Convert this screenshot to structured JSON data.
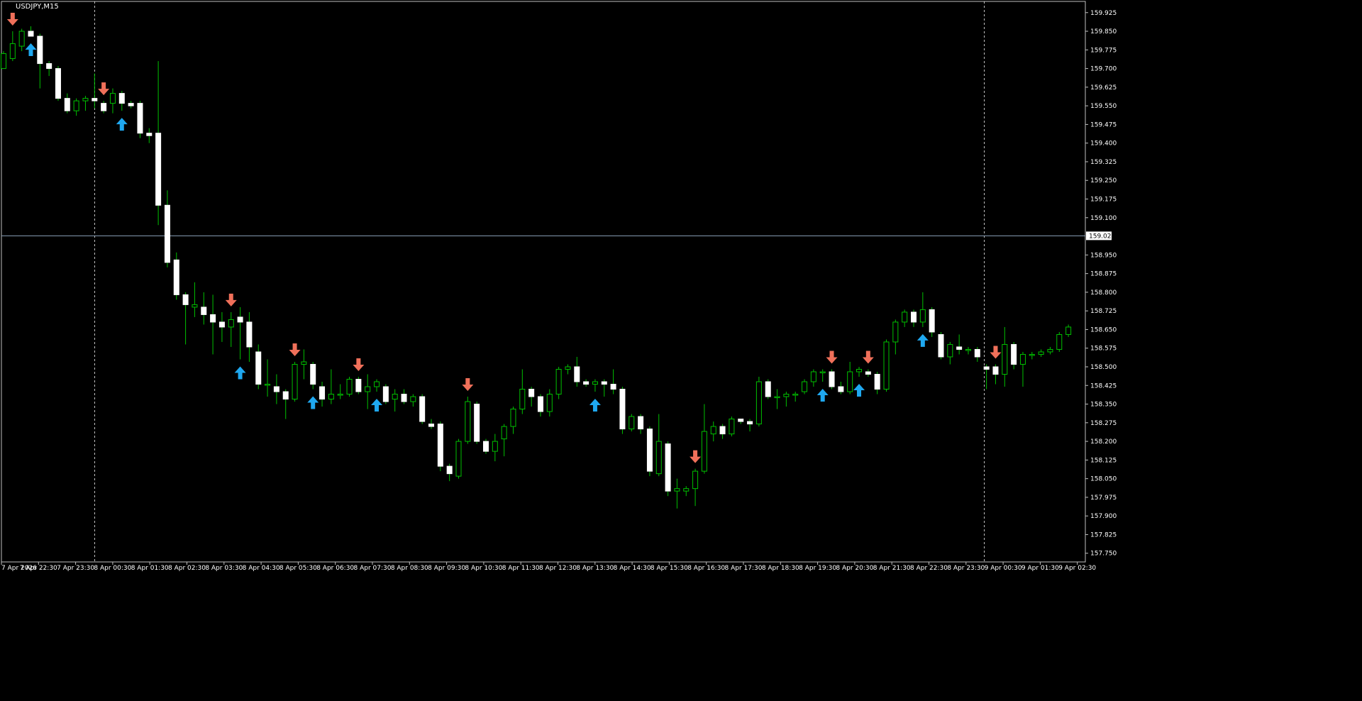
{
  "symbol_label": "USDJPY,M15",
  "current_price": "159.027",
  "colors": {
    "background": "#000000",
    "frame": "#c0c0c0",
    "axis_text": "#ffffff",
    "bull_body": "#000000",
    "bull_outline": "#00c000",
    "bear_body": "#ffffff",
    "wick": "#00c000",
    "price_line": "#8aa0b8",
    "separator": "#c0c0c0",
    "buy_arrow": "#1fa8f0",
    "sell_arrow": "#f0705a"
  },
  "chart_data": {
    "type": "candlestick",
    "symbol": "USDJPY",
    "timeframe": "M15",
    "ylim": [
      157.715,
      159.97
    ],
    "y_ticks": [
      "159.925",
      "159.850",
      "159.775",
      "159.700",
      "159.625",
      "159.550",
      "159.475",
      "159.400",
      "159.325",
      "159.250",
      "159.175",
      "159.100",
      "158.950",
      "158.875",
      "158.800",
      "158.725",
      "158.650",
      "158.575",
      "158.500",
      "158.425",
      "158.350",
      "158.275",
      "158.200",
      "158.125",
      "158.050",
      "157.975",
      "157.900",
      "157.825",
      "157.750"
    ],
    "x_ticks": [
      "7 Apr 2026",
      "7 Apr 22:30",
      "7 Apr 23:30",
      "8 Apr 00:30",
      "8 Apr 01:30",
      "8 Apr 02:30",
      "8 Apr 03:30",
      "8 Apr 04:30",
      "8 Apr 05:30",
      "8 Apr 06:30",
      "8 Apr 07:30",
      "8 Apr 08:30",
      "8 Apr 09:30",
      "8 Apr 10:30",
      "8 Apr 11:30",
      "8 Apr 12:30",
      "8 Apr 13:30",
      "8 Apr 14:30",
      "8 Apr 15:30",
      "8 Apr 16:30",
      "8 Apr 17:30",
      "8 Apr 18:30",
      "8 Apr 19:30",
      "8 Apr 20:30",
      "8 Apr 21:30",
      "8 Apr 22:30",
      "8 Apr 23:30",
      "9 Apr 00:30",
      "9 Apr 01:30",
      "9 Apr 02:30"
    ],
    "current_price": 159.027,
    "candles": [
      [
        159.7,
        159.76,
        159.7,
        159.77
      ],
      [
        159.74,
        159.8,
        159.73,
        159.85
      ],
      [
        159.79,
        159.85,
        159.77,
        159.86
      ],
      [
        159.85,
        159.83,
        159.83,
        159.87
      ],
      [
        159.83,
        159.72,
        159.62,
        159.84
      ],
      [
        159.72,
        159.7,
        159.67,
        159.73
      ],
      [
        159.7,
        159.58,
        159.57,
        159.71
      ],
      [
        159.58,
        159.53,
        159.52,
        159.6
      ],
      [
        159.53,
        159.57,
        159.51,
        159.58
      ],
      [
        159.57,
        159.58,
        159.53,
        159.59
      ],
      [
        159.58,
        159.57,
        159.54,
        159.68
      ],
      [
        159.56,
        159.53,
        159.52,
        159.57
      ],
      [
        159.56,
        159.6,
        159.52,
        159.62
      ],
      [
        159.6,
        159.56,
        159.53,
        159.61
      ],
      [
        159.56,
        159.55,
        159.54,
        159.57
      ],
      [
        159.56,
        159.44,
        159.42,
        159.57
      ],
      [
        159.44,
        159.43,
        159.4,
        159.46
      ],
      [
        159.44,
        159.15,
        159.07,
        159.73
      ],
      [
        159.15,
        158.92,
        158.9,
        159.21
      ],
      [
        158.93,
        158.79,
        158.77,
        158.96
      ],
      [
        158.79,
        158.75,
        158.59,
        158.8
      ],
      [
        158.74,
        158.75,
        158.7,
        158.84
      ],
      [
        158.74,
        158.71,
        158.67,
        158.8
      ],
      [
        158.71,
        158.68,
        158.55,
        158.79
      ],
      [
        158.68,
        158.66,
        158.6,
        158.72
      ],
      [
        158.66,
        158.69,
        158.58,
        158.72
      ],
      [
        158.7,
        158.68,
        158.53,
        158.74
      ],
      [
        158.68,
        158.58,
        158.52,
        158.72
      ],
      [
        158.56,
        158.43,
        158.41,
        158.59
      ],
      [
        158.43,
        158.43,
        158.38,
        158.53
      ],
      [
        158.42,
        158.4,
        158.35,
        158.47
      ],
      [
        158.4,
        158.37,
        158.29,
        158.41
      ],
      [
        158.37,
        158.51,
        158.36,
        158.52
      ],
      [
        158.51,
        158.52,
        158.45,
        158.57
      ],
      [
        158.51,
        158.43,
        158.41,
        158.52
      ],
      [
        158.42,
        158.37,
        158.34,
        158.44
      ],
      [
        158.37,
        158.39,
        158.35,
        158.49
      ],
      [
        158.39,
        158.39,
        158.37,
        158.43
      ],
      [
        158.39,
        158.45,
        158.38,
        158.46
      ],
      [
        158.45,
        158.4,
        158.39,
        158.46
      ],
      [
        158.4,
        158.42,
        158.33,
        158.47
      ],
      [
        158.42,
        158.44,
        158.4,
        158.45
      ],
      [
        158.42,
        158.36,
        158.35,
        158.43
      ],
      [
        158.37,
        158.39,
        158.32,
        158.41
      ],
      [
        158.39,
        158.36,
        158.35,
        158.41
      ],
      [
        158.36,
        158.38,
        158.34,
        158.39
      ],
      [
        158.38,
        158.28,
        158.27,
        158.39
      ],
      [
        158.27,
        158.26,
        158.25,
        158.29
      ],
      [
        158.27,
        158.1,
        158.08,
        158.28
      ],
      [
        158.1,
        158.07,
        158.04,
        158.11
      ],
      [
        158.06,
        158.2,
        158.05,
        158.21
      ],
      [
        158.2,
        158.36,
        158.19,
        158.38
      ],
      [
        158.35,
        158.2,
        158.19,
        158.36
      ],
      [
        158.2,
        158.16,
        158.15,
        158.21
      ],
      [
        158.16,
        158.2,
        158.12,
        158.23
      ],
      [
        158.21,
        158.26,
        158.14,
        158.27
      ],
      [
        158.26,
        158.33,
        158.23,
        158.34
      ],
      [
        158.33,
        158.41,
        158.31,
        158.49
      ],
      [
        158.41,
        158.38,
        158.34,
        158.42
      ],
      [
        158.38,
        158.32,
        158.3,
        158.39
      ],
      [
        158.32,
        158.39,
        158.3,
        158.41
      ],
      [
        158.39,
        158.49,
        158.37,
        158.5
      ],
      [
        158.49,
        158.5,
        158.47,
        158.51
      ],
      [
        158.5,
        158.44,
        158.42,
        158.54
      ],
      [
        158.44,
        158.43,
        158.42,
        158.45
      ],
      [
        158.43,
        158.44,
        158.4,
        158.45
      ],
      [
        158.44,
        158.43,
        158.38,
        158.45
      ],
      [
        158.43,
        158.41,
        158.39,
        158.49
      ],
      [
        158.41,
        158.25,
        158.23,
        158.42
      ],
      [
        158.25,
        158.3,
        158.24,
        158.31
      ],
      [
        158.3,
        158.25,
        158.23,
        158.31
      ],
      [
        158.25,
        158.08,
        158.06,
        158.26
      ],
      [
        158.07,
        158.2,
        158.06,
        158.31
      ],
      [
        158.19,
        158.0,
        157.98,
        158.2
      ],
      [
        158.0,
        158.01,
        157.93,
        158.05
      ],
      [
        158.0,
        158.01,
        157.98,
        158.02
      ],
      [
        158.01,
        158.08,
        157.94,
        158.09
      ],
      [
        158.08,
        158.24,
        158.07,
        158.35
      ],
      [
        158.23,
        158.26,
        158.2,
        158.28
      ],
      [
        158.26,
        158.23,
        158.21,
        158.27
      ],
      [
        158.23,
        158.29,
        158.22,
        158.3
      ],
      [
        158.29,
        158.28,
        158.27,
        158.29
      ],
      [
        158.28,
        158.27,
        158.24,
        158.29
      ],
      [
        158.27,
        158.44,
        158.26,
        158.46
      ],
      [
        158.44,
        158.38,
        158.37,
        158.45
      ],
      [
        158.38,
        158.38,
        158.33,
        158.41
      ],
      [
        158.38,
        158.39,
        158.34,
        158.4
      ],
      [
        158.39,
        158.39,
        158.36,
        158.4
      ],
      [
        158.4,
        158.44,
        158.39,
        158.45
      ],
      [
        158.44,
        158.48,
        158.42,
        158.49
      ],
      [
        158.48,
        158.48,
        158.44,
        158.49
      ],
      [
        158.48,
        158.42,
        158.41,
        158.49
      ],
      [
        158.42,
        158.4,
        158.39,
        158.44
      ],
      [
        158.4,
        158.48,
        158.39,
        158.52
      ],
      [
        158.48,
        158.49,
        158.46,
        158.5
      ],
      [
        158.48,
        158.47,
        158.46,
        158.49
      ],
      [
        158.47,
        158.41,
        158.39,
        158.48
      ],
      [
        158.41,
        158.6,
        158.4,
        158.61
      ],
      [
        158.6,
        158.68,
        158.55,
        158.69
      ],
      [
        158.68,
        158.72,
        158.66,
        158.73
      ],
      [
        158.72,
        158.68,
        158.66,
        158.73
      ],
      [
        158.68,
        158.73,
        158.66,
        158.8
      ],
      [
        158.73,
        158.64,
        158.62,
        158.74
      ],
      [
        158.63,
        158.54,
        158.53,
        158.64
      ],
      [
        158.54,
        158.59,
        158.51,
        158.6
      ],
      [
        158.58,
        158.57,
        158.55,
        158.63
      ],
      [
        158.57,
        158.57,
        158.55,
        158.58
      ],
      [
        158.57,
        158.54,
        158.52,
        158.58
      ],
      [
        158.5,
        158.49,
        158.41,
        158.51
      ],
      [
        158.5,
        158.47,
        158.43,
        158.51
      ],
      [
        158.47,
        158.59,
        158.42,
        158.66
      ],
      [
        158.59,
        158.51,
        158.49,
        158.6
      ],
      [
        158.51,
        158.55,
        158.42,
        158.56
      ],
      [
        158.55,
        158.55,
        158.53,
        158.56
      ],
      [
        158.55,
        158.56,
        158.54,
        158.57
      ],
      [
        158.56,
        158.57,
        158.55,
        158.58
      ],
      [
        158.57,
        158.63,
        158.56,
        158.64
      ],
      [
        158.63,
        158.66,
        158.62,
        158.67
      ]
    ],
    "buy_signals": [
      3,
      13,
      26,
      34,
      41,
      65,
      90,
      94,
      101
    ],
    "sell_signals": [
      1,
      11,
      25,
      32,
      39,
      51,
      76,
      91,
      95,
      109
    ]
  }
}
